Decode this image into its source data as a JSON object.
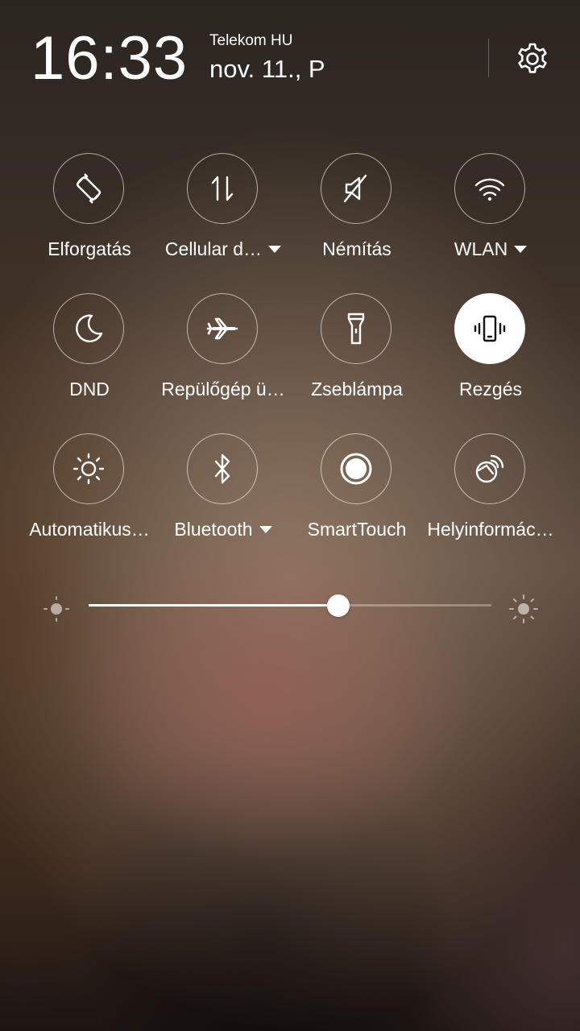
{
  "status": {
    "time": "16:33",
    "carrier": "Telekom HU",
    "date": "nov. 11., P"
  },
  "tiles": [
    {
      "label": "Elforgatás",
      "icon": "rotate-icon",
      "active": false,
      "dropdown": false
    },
    {
      "label": "Cellular d…",
      "icon": "cellular-data-icon",
      "active": false,
      "dropdown": true
    },
    {
      "label": "Némítás",
      "icon": "mute-icon",
      "active": false,
      "dropdown": false
    },
    {
      "label": "WLAN",
      "icon": "wifi-icon",
      "active": false,
      "dropdown": true
    },
    {
      "label": "DND",
      "icon": "moon-icon",
      "active": false,
      "dropdown": false
    },
    {
      "label": "Repülőgép ü…",
      "icon": "airplane-icon",
      "active": false,
      "dropdown": false
    },
    {
      "label": "Zseblámpa",
      "icon": "flashlight-icon",
      "active": false,
      "dropdown": false
    },
    {
      "label": "Rezgés",
      "icon": "vibrate-icon",
      "active": true,
      "dropdown": false
    },
    {
      "label": "Automatikus…",
      "icon": "brightness-auto-icon",
      "active": false,
      "dropdown": false
    },
    {
      "label": "Bluetooth",
      "icon": "bluetooth-icon",
      "active": false,
      "dropdown": true
    },
    {
      "label": "SmartTouch",
      "icon": "smarttouch-icon",
      "active": false,
      "dropdown": false
    },
    {
      "label": "Helyinformác…",
      "icon": "location-icon",
      "active": false,
      "dropdown": false
    }
  ],
  "brightness": {
    "level": 0.62
  },
  "colors": {
    "active_tile_bg": "#ffffff",
    "active_icon": "#111111"
  }
}
